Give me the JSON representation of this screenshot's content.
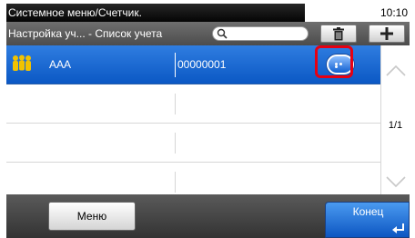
{
  "header": {
    "breadcrumb": "Системное меню/Счетчик.",
    "time": "10:10",
    "subtitle": "Настройка уч... - Список учета"
  },
  "toolbar": {
    "search_icon": "search-icon",
    "delete_icon": "trash-icon",
    "add_icon": "plus-icon"
  },
  "accounts": [
    {
      "icon": "group-icon",
      "name": "AAA",
      "number": "00000001",
      "selected": true,
      "detail_icon": "more-icon"
    }
  ],
  "pagination": {
    "page": "1/1"
  },
  "footer": {
    "menu_label": "Меню",
    "end_label": "Конец"
  },
  "colors": {
    "accent": "#0b58c4",
    "highlight": "#e60012"
  }
}
